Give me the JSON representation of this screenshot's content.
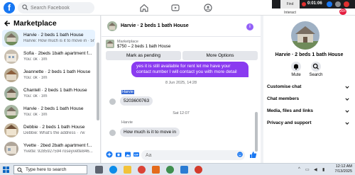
{
  "top_bar": {
    "logo": "f",
    "search_placeholder": "Search Facebook",
    "recorder_panel_label": "Find Interact",
    "recorder_time": "0:01:06",
    "notification_count": "20+"
  },
  "sidebar": {
    "title": "Marketplace",
    "items": [
      {
        "title": "Harvie · 2 beds 1 bath House",
        "subtitle": "Harvie: How much is it to move in · 5m",
        "active": true
      },
      {
        "title": "Sofia · 2beds 1bath apartment f...",
        "subtitle": "You: ok · 3m",
        "active": false
      },
      {
        "title": "Jeannette · 2 beds 1 bath House",
        "subtitle": "You: ok · 3m",
        "active": false
      },
      {
        "title": "Chantell · 2 beds 1 bath House",
        "subtitle": "You: ok · 3m",
        "active": false
      },
      {
        "title": "Harvie · 2 beds 1 bath House",
        "subtitle": "You: ok · 3m",
        "active": false
      },
      {
        "title": "Debbie · 2 beds 1 bath House",
        "subtitle": "Debbie: What's the address · 7w",
        "active": false
      },
      {
        "title": "Yvette · 2bed 2bath apartment f...",
        "subtitle": "Yvette: 9285927594 roseyvette846... · 7w",
        "active": false
      }
    ]
  },
  "chat": {
    "header_name": "Harvie · 2 beds 1 bath House",
    "info_glyph": "i",
    "listing_label": "Marketplace",
    "listing_price_title": "$750 – 2 beds 1 bath House",
    "mark_pending_label": "Mark as pending",
    "more_options_label": "More Options",
    "outgoing_message": "yes it is still available for rent let me have your contact number I will contact you with more detail",
    "timestamp_1": "8 Jun 2025, 14:28",
    "sender_1": "Harvie",
    "incoming_1": "5203600763",
    "timestamp_2": "Sat 12:07",
    "sender_2": "Harvie",
    "incoming_2": "How much is it to move in",
    "composer_placeholder": "Aa"
  },
  "right_panel": {
    "name": "Harvie · 2 beds 1 bath House",
    "actions": [
      {
        "label": "Mute",
        "icon": "bell-icon"
      },
      {
        "label": "Search",
        "icon": "search-icon"
      }
    ],
    "sections": [
      "Customise chat",
      "Chat members",
      "Media, files and links",
      "Privacy and support"
    ]
  },
  "taskbar": {
    "search_text": "Type here to search",
    "time": "12:12 AM",
    "date": "7/13/2025"
  },
  "colors": {
    "facebook_blue": "#1877f2",
    "outgoing_bubble": "#8a3bf0",
    "active_item": "#e7f3ff"
  }
}
